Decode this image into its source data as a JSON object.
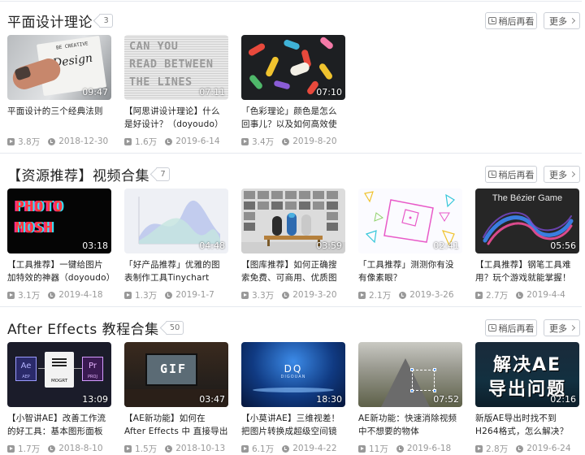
{
  "sections": [
    {
      "title": "平面设计理论",
      "count": "3",
      "watch_later": "稍后再看",
      "more": "更多",
      "videos": [
        {
          "title": "平面设计的三个经典法则",
          "duration": "09:47",
          "plays": "3.8万",
          "date": "2018-12-30",
          "thumb": "design"
        },
        {
          "title": "【阿思讲设计理论】什么是好设计？（doyoudo）",
          "duration": "07:11",
          "plays": "1.6万",
          "date": "2019-6-14",
          "thumb": "read"
        },
        {
          "title": "「色彩理论」颜色是怎么回事儿？以及如何高效使用",
          "duration": "07:10",
          "plays": "3.4万",
          "date": "2019-8-20",
          "thumb": "color"
        }
      ],
      "thumb_text": {
        "read_lines": [
          "CAN YOU",
          "READ BETWEEN",
          "THE LINES"
        ],
        "design_word": "Design",
        "design_small": "BE CREATIVE"
      }
    },
    {
      "title": "【资源推荐】视频合集",
      "count": "7",
      "watch_later": "稍后再看",
      "more": "更多",
      "videos": [
        {
          "title": "【工具推荐】一键给图片加特效的神器（doyoudo）",
          "duration": "03:18",
          "plays": "3.1万",
          "date": "2019-4-18",
          "thumb": "photo"
        },
        {
          "title": "「好产品推荐」优雅的图表制作工具Tinychart",
          "duration": "04:48",
          "plays": "1.3万",
          "date": "2019-1-7",
          "thumb": "chart"
        },
        {
          "title": "【图库推荐】如何正确搜索免费、可商用、优质图片",
          "duration": "03:59",
          "plays": "3.3万",
          "date": "2019-3-20",
          "thumb": "gallery"
        },
        {
          "title": "「工具推荐」测测你有没有像素眼？",
          "duration": "02:41",
          "plays": "2.1万",
          "date": "2019-3-26",
          "thumb": "geo"
        },
        {
          "title": "【工具推荐】钢笔工具难用？玩个游戏就能掌握！",
          "duration": "05:56",
          "plays": "2.7万",
          "date": "2019-4-4",
          "thumb": "bezier"
        }
      ],
      "thumb_text": {
        "photo_1": "PHOTO",
        "photo_2": "MOSH",
        "bezier": "The Bézier Game"
      }
    },
    {
      "title": "After Effects 教程合集",
      "count": "50",
      "watch_later": "稍后再看",
      "more": "更多",
      "videos": [
        {
          "title": "【小智讲AE】改善工作流的好工具：基本图形面板",
          "duration": "13:09",
          "plays": "1.7万",
          "date": "2018-8-10",
          "thumb": "ae"
        },
        {
          "title": "【AE新功能】如何在 After Effects 中 直接导出 GIF 动",
          "duration": "03:47",
          "plays": "1.5万",
          "date": "2018-10-13",
          "thumb": "gif"
        },
        {
          "title": "【小莫讲AE】三维视差！把图片转换成超级空间镜头的正",
          "duration": "18:30",
          "plays": "6.1万",
          "date": "2019-4-22",
          "thumb": "dq"
        },
        {
          "title": "AE新功能：快速消除视频中不想要的物体",
          "duration": "07:52",
          "plays": "11万",
          "date": "2019-6-18",
          "thumb": "road"
        },
        {
          "title": "新版AE导出时找不到H264格式，怎么解决？",
          "duration": "02:16",
          "plays": "2.8万",
          "date": "2019-6-24",
          "thumb": "jj"
        }
      ],
      "thumb_text": {
        "ae": "Ae",
        "ae_sub": "AEP",
        "pr": "Pr",
        "pr_sub": "PROJ",
        "mogrt": "MOGRT",
        "gif": "GIF",
        "dq": "DQ",
        "dq_sub": "DIGOUAN",
        "jj_1": "解决AE",
        "jj_2": "导出问题"
      }
    }
  ]
}
